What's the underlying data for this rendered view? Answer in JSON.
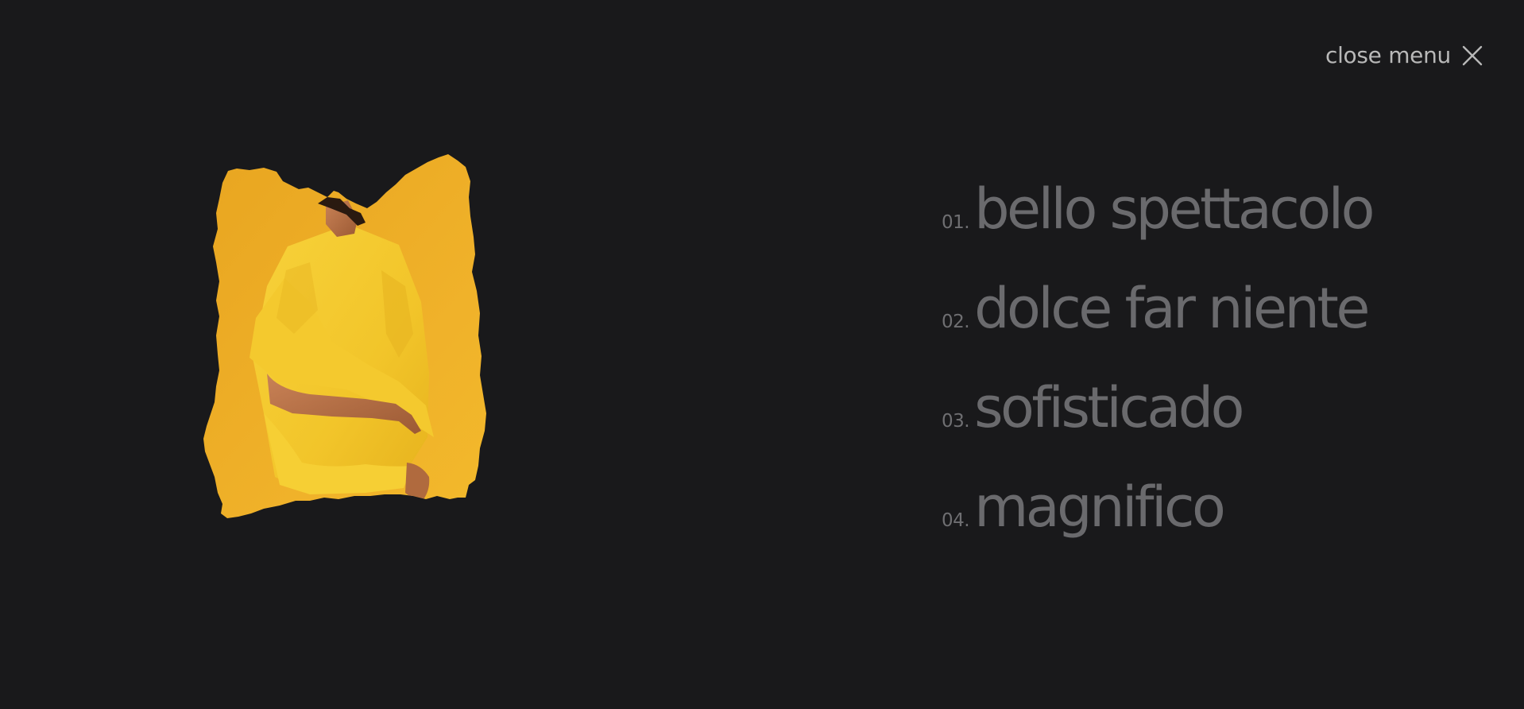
{
  "header": {
    "close_label": "close menu",
    "close_icon": "close-icon"
  },
  "colors": {
    "background": "#19191b",
    "menu_text": "#6a6a6d",
    "close_text": "#b8b8b8",
    "accent_yellow": "#f0b323"
  },
  "menu": {
    "items": [
      {
        "number": "01.",
        "label": "bello spettacolo"
      },
      {
        "number": "02.",
        "label": "dolce far niente"
      },
      {
        "number": "03.",
        "label": "sofisticado"
      },
      {
        "number": "04.",
        "label": "magnifico"
      }
    ]
  }
}
